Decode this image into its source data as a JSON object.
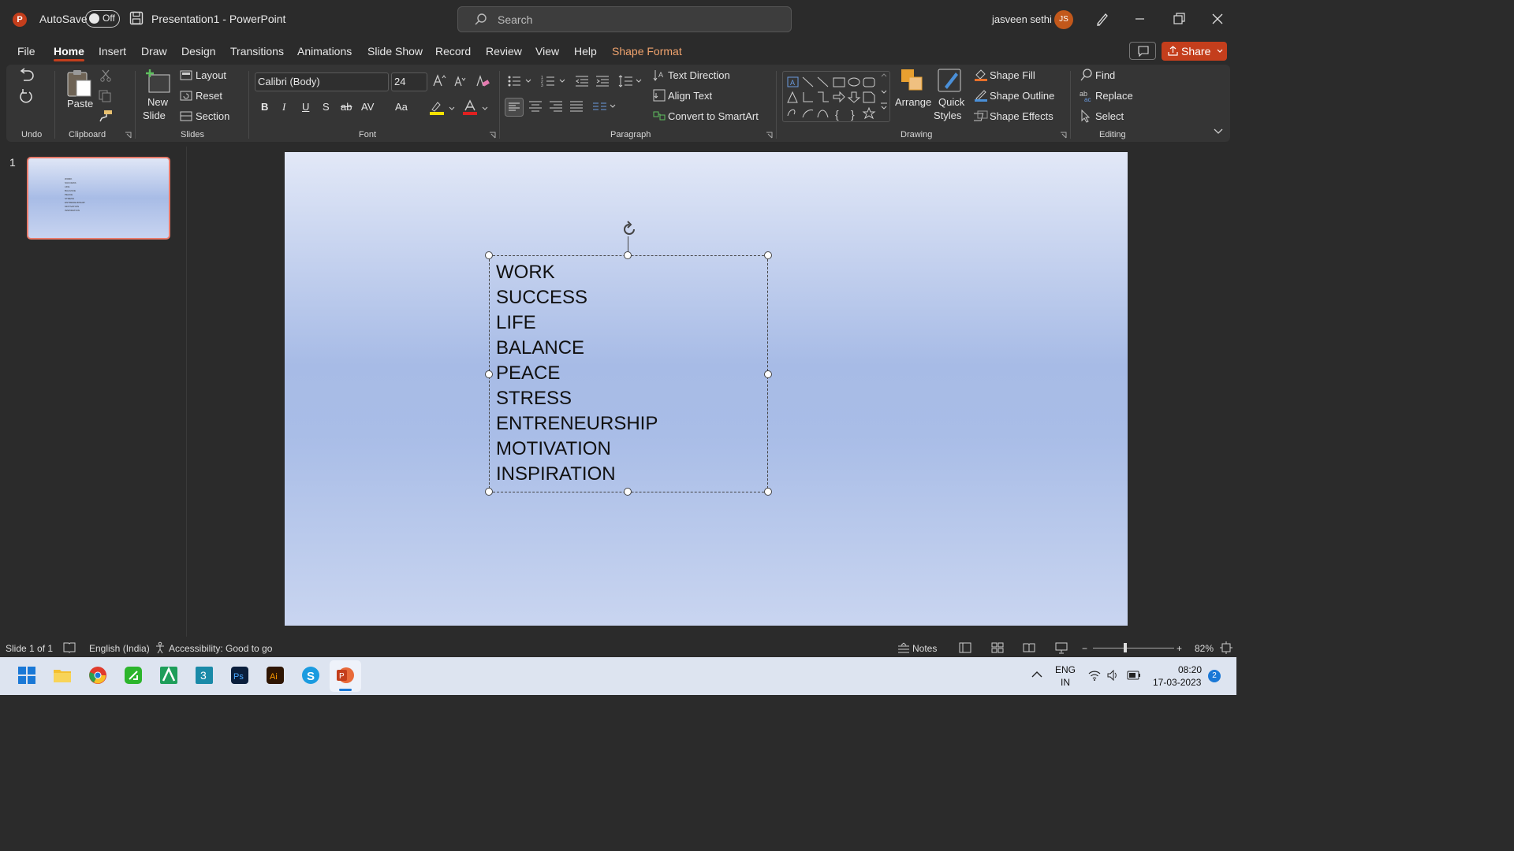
{
  "titlebar": {
    "autosave_label": "AutoSave",
    "autosave_state": "Off",
    "doc_title": "Presentation1  -  PowerPoint",
    "search_placeholder": "Search",
    "user_name": "jasveen sethi",
    "user_initials": "JS"
  },
  "menu": {
    "tabs": [
      "File",
      "Home",
      "Insert",
      "Draw",
      "Design",
      "Transitions",
      "Animations",
      "Slide Show",
      "Record",
      "Review",
      "View",
      "Help",
      "Shape Format"
    ],
    "active": "Home",
    "share_label": "Share"
  },
  "ribbon": {
    "groups": [
      "Undo",
      "Clipboard",
      "Slides",
      "Font",
      "Paragraph",
      "Drawing",
      "Editing"
    ],
    "paste_label": "Paste",
    "new_slide_label1": "New",
    "new_slide_label2": "Slide",
    "layout_label": "Layout",
    "reset_label": "Reset",
    "section_label": "Section",
    "font_name": "Calibri (Body)",
    "font_size": "24",
    "bold": "B",
    "italic": "I",
    "underline": "U",
    "shadow": "S",
    "strike": "ab",
    "spacing": "AV",
    "case": "Aa",
    "text_direction": "Text Direction",
    "align_text": "Align Text",
    "convert_smartart": "Convert to SmartArt",
    "arrange_label": "Arrange",
    "quick_styles_1": "Quick",
    "quick_styles_2": "Styles",
    "shape_fill": "Shape Fill",
    "shape_outline": "Shape Outline",
    "shape_effects": "Shape Effects",
    "find": "Find",
    "replace": "Replace",
    "select": "Select"
  },
  "slides_pane": {
    "slide_number": "1",
    "thumb_lines": [
      "WORK",
      "SUCCESS",
      "LIFE",
      "BALANCE",
      "PEACE",
      "STRESS",
      "ENTRENEURSHIP",
      "MOTIVATION",
      "INSPIRATION"
    ]
  },
  "slide": {
    "lines": [
      "WORK",
      "SUCCESS",
      "LIFE",
      "BALANCE",
      "PEACE",
      "STRESS",
      "ENTRENEURSHIP",
      "MOTIVATION",
      "INSPIRATION"
    ]
  },
  "status": {
    "slide_info": "Slide 1 of 1",
    "language": "English (India)",
    "accessibility": "Accessibility: Good to go",
    "notes": "Notes",
    "zoom": "82%"
  },
  "taskbar": {
    "lang1": "ENG",
    "lang2": "IN",
    "time": "08:20",
    "date": "17-03-2023",
    "notif_count": "2"
  },
  "colors": {
    "accent": "#c43e1c",
    "shape_format": "#f0a36e"
  }
}
